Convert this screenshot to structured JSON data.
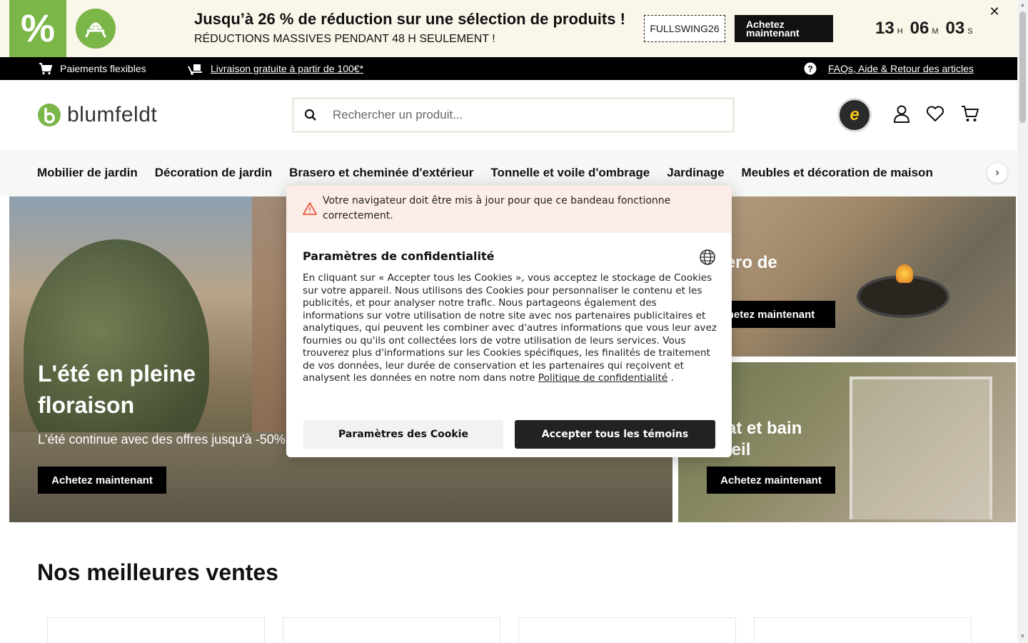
{
  "promo": {
    "percent_symbol": "%",
    "title": "Jusqu’à 26 % de réduction sur une sélection de produits !",
    "subtitle": "RÉDUCTIONS MASSIVES PENDANT 48 H SEULEMENT !",
    "code": "FULLSWING26",
    "cta": "Achetez maintenant",
    "timer": {
      "hours": "13",
      "hours_unit": "H",
      "minutes": "06",
      "minutes_unit": "M",
      "seconds": "03",
      "seconds_unit": "S"
    },
    "close": "✕",
    "accent": "#7ab648"
  },
  "infobar": {
    "payments": "Paiements flexibles",
    "shipping": "Livraison gratuite à partir de 100€*",
    "faq": "FAQs, Aide & Retour des articles"
  },
  "header": {
    "logo": "blumfeldt",
    "search_placeholder": "Rechercher un produit...",
    "trusted_letter": "e"
  },
  "nav": {
    "items": [
      "Mobilier de jardin",
      "Décoration de jardin",
      "Brasero et cheminée d'extérieur",
      "Tonnelle et voile d'ombrage",
      "Jardinage",
      "Meubles et décoration de maison"
    ],
    "next": "›"
  },
  "hero": {
    "title": "L'été en pleine floraison",
    "subtitle": "L'été continue avec des offres jusqu'à -50%",
    "cta": "Achetez maintenant"
  },
  "tiles": [
    {
      "title": "asero de\ndin",
      "cta": "hetez maintenant"
    },
    {
      "title": "nsat et bain\nsoleil",
      "cta": "Achetez maintenant"
    }
  ],
  "section": {
    "title": "Nos meilleures ventes"
  },
  "cookie_modal": {
    "warning": "Votre navigateur doit être mis à jour pour que ce bandeau fonctionne correctement.",
    "title": "Paramètres de confidentialité",
    "body": "En cliquant sur « Accepter tous les Cookies », vous acceptez le stockage de Cookies sur votre appareil. Nous utilisons des Cookies pour personnaliser le contenu et les publicités, et pour analyser notre trafic. Nous partageons également des informations sur votre utilisation de notre site avec nos partenaires publicitaires et analytiques, qui peuvent les combiner avec d'autres informations que vous leur avez fournies ou qu'ils ont collectées lors de votre utilisation de leurs services. Vous trouverez plus d'informations sur les Cookies spécifiques, les finalités de traitement de vos données, leur durée de conservation et les partenaires qui reçoivent et analysent les données en notre nom dans notre ",
    "policy_link": "Politique de confidentialité",
    "body_end": " .",
    "settings_button": "Paramètres des Cookie",
    "accept_button": "Accepter tous les témoins"
  }
}
